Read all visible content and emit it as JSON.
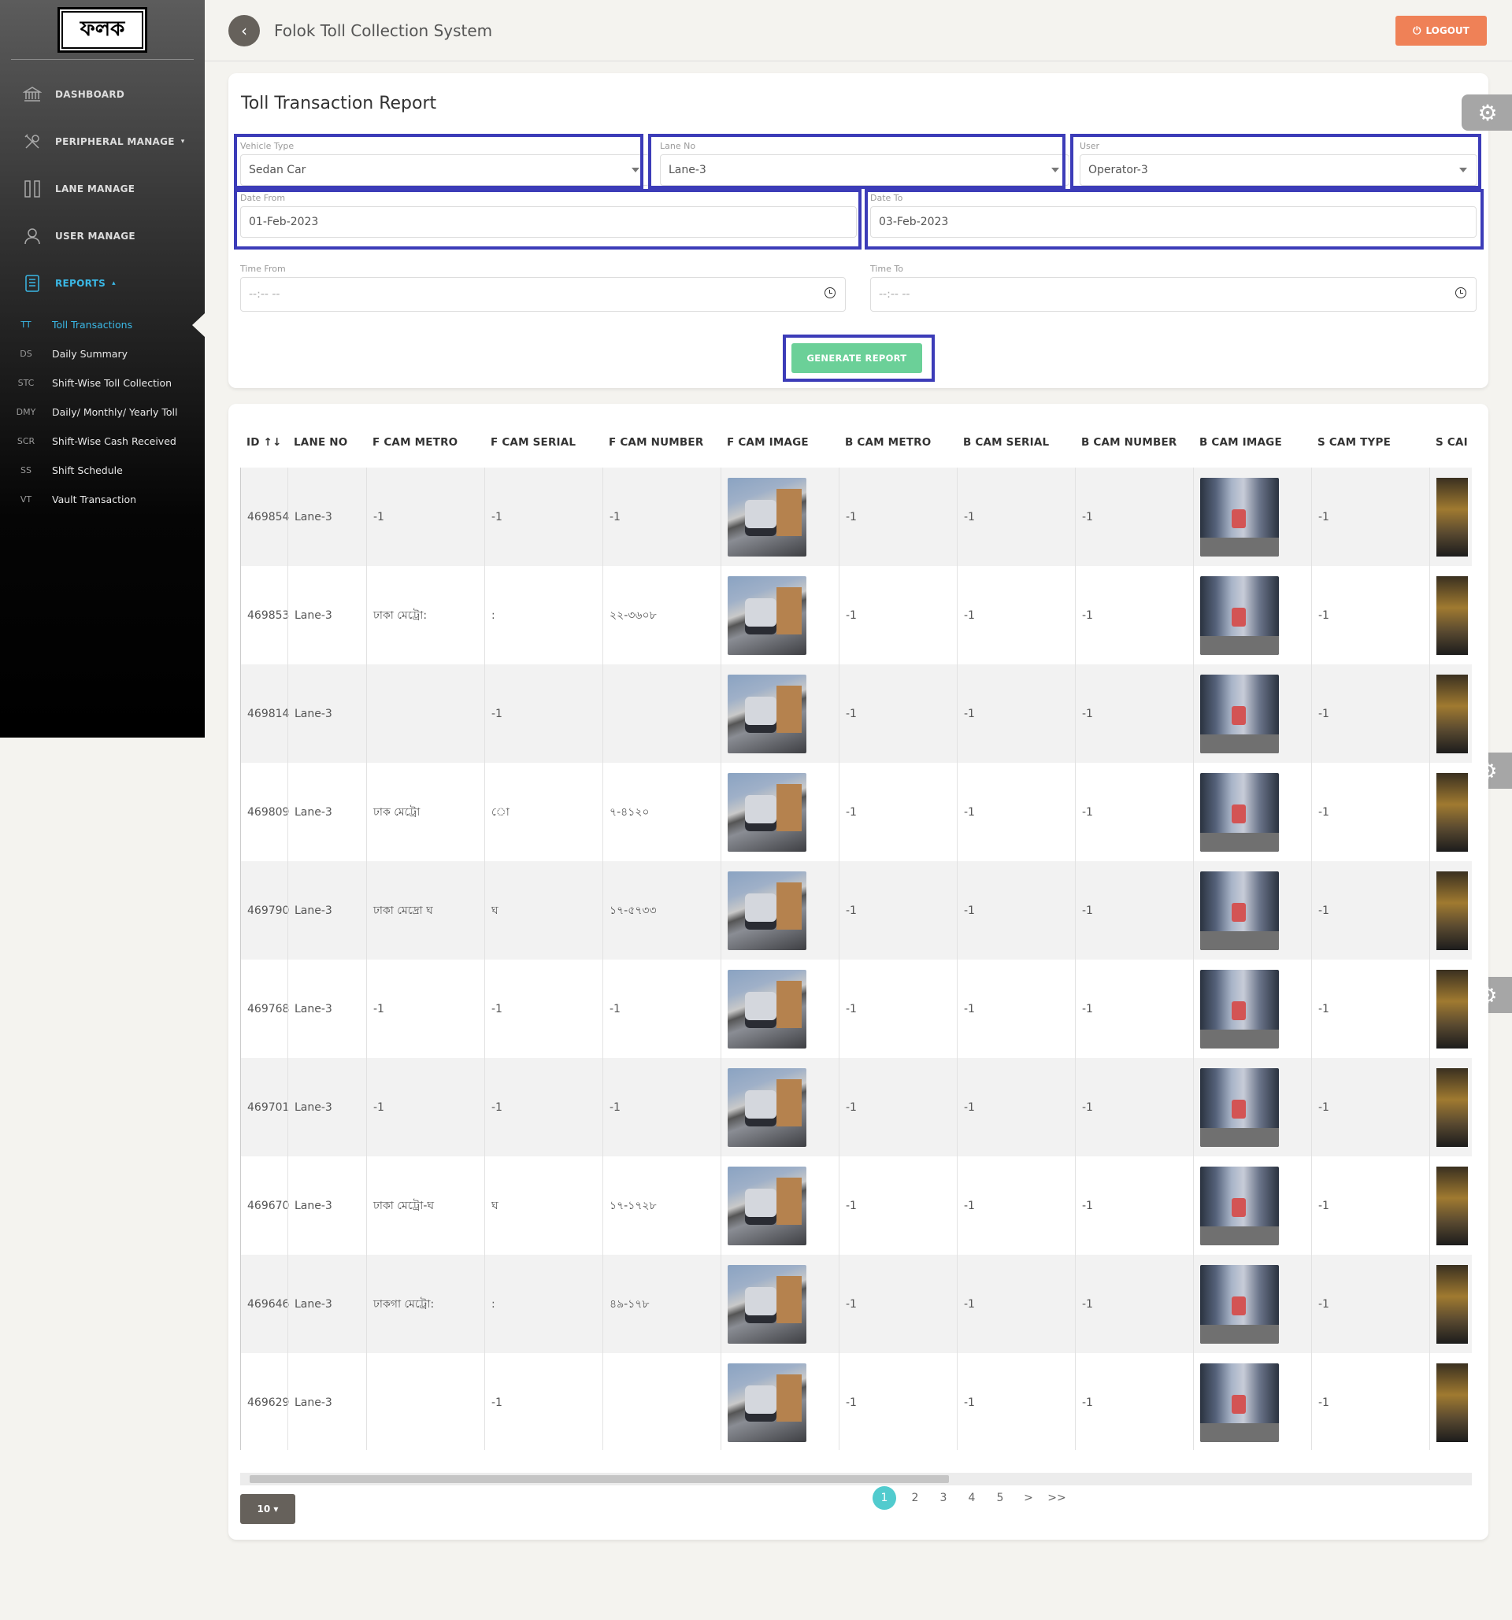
{
  "logo_text": "ফলক",
  "sidebar": {
    "items": [
      {
        "label": "DASHBOARD",
        "icon": "bank-icon"
      },
      {
        "label": "PERIPHERAL MANAGE",
        "icon": "tools-icon",
        "caret": "▾"
      },
      {
        "label": "LANE MANAGE",
        "icon": "lanes-icon"
      },
      {
        "label": "USER MANAGE",
        "icon": "user-icon"
      },
      {
        "label": "REPORTS",
        "icon": "report-icon",
        "caret": "▴"
      }
    ],
    "subitems": [
      {
        "abbr": "TT",
        "label": "Toll Transactions"
      },
      {
        "abbr": "DS",
        "label": "Daily Summary"
      },
      {
        "abbr": "STC",
        "label": "Shift-Wise Toll Collection"
      },
      {
        "abbr": "DMY",
        "label": "Daily/ Monthly/ Yearly Toll"
      },
      {
        "abbr": "SCR",
        "label": "Shift-Wise Cash Received"
      },
      {
        "abbr": "SS",
        "label": "Shift Schedule"
      },
      {
        "abbr": "VT",
        "label": "Vault Transaction"
      }
    ]
  },
  "header": {
    "title": "Folok Toll Collection System",
    "logout": "LOGOUT"
  },
  "report": {
    "title": "Toll Transaction Report",
    "vehicle_type": {
      "label": "Vehicle Type",
      "value": "Sedan Car"
    },
    "lane_no": {
      "label": "Lane No",
      "value": "Lane-3"
    },
    "user": {
      "label": "User",
      "value": "Operator-3"
    },
    "date_from": {
      "label": "Date From",
      "value": "01-Feb-2023"
    },
    "date_to": {
      "label": "Date To",
      "value": "03-Feb-2023"
    },
    "time_from": {
      "label": "Time From",
      "value": "--:-- --"
    },
    "time_to": {
      "label": "Time To",
      "value": "--:-- --"
    },
    "generate_button": "GENERATE REPORT"
  },
  "table": {
    "columns": [
      "ID ↑↓",
      "LANE NO",
      "F CAM METRO",
      "F CAM SERIAL",
      "F CAM NUMBER",
      "F CAM IMAGE",
      "B CAM METRO",
      "B CAM SERIAL",
      "B CAM NUMBER",
      "B CAM IMAGE",
      "S CAM TYPE",
      "S CAI"
    ],
    "rows": [
      {
        "id": "469854",
        "lane": "Lane-3",
        "f_metro": "-1",
        "f_serial": "-1",
        "f_number": "-1",
        "b_metro": "-1",
        "b_serial": "-1",
        "b_number": "-1",
        "s_type": "-1"
      },
      {
        "id": "469853",
        "lane": "Lane-3",
        "f_metro": "ঢাকা মেট্রো:",
        "f_serial": ":",
        "f_number": "২২-৩৬০৮",
        "b_metro": "-1",
        "b_serial": "-1",
        "b_number": "-1",
        "s_type": "-1"
      },
      {
        "id": "469814",
        "lane": "Lane-3",
        "f_metro": "",
        "f_serial": "-1",
        "f_number": "",
        "b_metro": "-1",
        "b_serial": "-1",
        "b_number": "-1",
        "s_type": "-1"
      },
      {
        "id": "469809",
        "lane": "Lane-3",
        "f_metro": "ঢাক মেট্রো",
        "f_serial": "ো",
        "f_number": "৭-৪১২০",
        "b_metro": "-1",
        "b_serial": "-1",
        "b_number": "-1",
        "s_type": "-1"
      },
      {
        "id": "469790",
        "lane": "Lane-3",
        "f_metro": "ঢাকা মেদ্রো ঘ",
        "f_serial": "ঘ",
        "f_number": "১৭-৫৭৩৩",
        "b_metro": "-1",
        "b_serial": "-1",
        "b_number": "-1",
        "s_type": "-1"
      },
      {
        "id": "469768",
        "lane": "Lane-3",
        "f_metro": "-1",
        "f_serial": "-1",
        "f_number": "-1",
        "b_metro": "-1",
        "b_serial": "-1",
        "b_number": "-1",
        "s_type": "-1"
      },
      {
        "id": "469701",
        "lane": "Lane-3",
        "f_metro": "-1",
        "f_serial": "-1",
        "f_number": "-1",
        "b_metro": "-1",
        "b_serial": "-1",
        "b_number": "-1",
        "s_type": "-1"
      },
      {
        "id": "469670",
        "lane": "Lane-3",
        "f_metro": "ঢাকা মেট্রো-ঘ",
        "f_serial": "ঘ",
        "f_number": "১৭-১৭২৮",
        "b_metro": "-1",
        "b_serial": "-1",
        "b_number": "-1",
        "s_type": "-1"
      },
      {
        "id": "469646",
        "lane": "Lane-3",
        "f_metro": "ঢাকগা মেট্রো:",
        "f_serial": ":",
        "f_number": "৪৯-১৭৮",
        "b_metro": "-1",
        "b_serial": "-1",
        "b_number": "-1",
        "s_type": "-1"
      },
      {
        "id": "469629",
        "lane": "Lane-3",
        "f_metro": "",
        "f_serial": "-1",
        "f_number": "",
        "b_metro": "-1",
        "b_serial": "-1",
        "b_number": "-1",
        "s_type": "-1"
      }
    ]
  },
  "pagination": {
    "page_size": "10 ▾",
    "pages": [
      "1",
      "2",
      "3",
      "4",
      "5",
      ">",
      ">>"
    ],
    "current": "1"
  },
  "colors": {
    "accent": "#3ab8e6",
    "logout": "#ef8157",
    "generate": "#6bd098",
    "highlight": "#3c3cb8",
    "current_page": "#51cbce"
  }
}
